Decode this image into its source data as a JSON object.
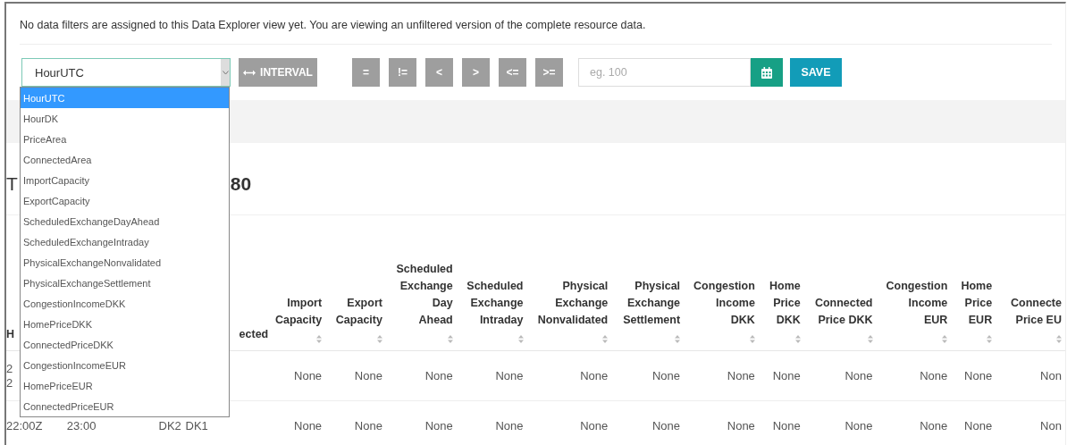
{
  "notice": "No data filters are assigned to this Data Explorer view yet. You are viewing an unfiltered version of the complete resource data.",
  "filter": {
    "field_select": {
      "value": "HourUTC",
      "expanded": true,
      "options": [
        {
          "label": "HourUTC",
          "selected": true
        },
        {
          "label": "HourDK",
          "selected": false
        },
        {
          "label": "PriceArea",
          "selected": false
        },
        {
          "label": "ConnectedArea",
          "selected": false
        },
        {
          "label": "ImportCapacity",
          "selected": false
        },
        {
          "label": "ExportCapacity",
          "selected": false
        },
        {
          "label": "ScheduledExchangeDayAhead",
          "selected": false
        },
        {
          "label": "ScheduledExchangeIntraday",
          "selected": false
        },
        {
          "label": "PhysicalExchangeNonvalidated",
          "selected": false
        },
        {
          "label": "PhysicalExchangeSettlement",
          "selected": false
        },
        {
          "label": "CongestionIncomeDKK",
          "selected": false
        },
        {
          "label": "HomePriceDKK",
          "selected": false
        },
        {
          "label": "ConnectedPriceDKK",
          "selected": false
        },
        {
          "label": "CongestionIncomeEUR",
          "selected": false
        },
        {
          "label": "HomePriceEUR",
          "selected": false
        },
        {
          "label": "ConnectedPriceEUR",
          "selected": false
        }
      ]
    },
    "interval_button": "INTERVAL",
    "operators": [
      "=",
      "!=",
      "<",
      ">",
      "<=",
      ">="
    ],
    "value_field": {
      "placeholder": "eg. 100"
    },
    "save_button": "SAVE"
  },
  "heading": {
    "lead": "T",
    "count": "80"
  },
  "table": {
    "columns": [
      {
        "label": "H",
        "sort": false
      },
      {
        "sort": false
      },
      {
        "sort": false
      },
      {
        "label": "ected",
        "sort": false
      },
      {
        "label": "Import\nCapacity",
        "sort": true
      },
      {
        "label": "Export\nCapacity",
        "sort": true
      },
      {
        "label": "Scheduled\nExchange\nDay\nAhead",
        "sort": true
      },
      {
        "label": "Scheduled\nExchange\nIntraday",
        "sort": true
      },
      {
        "label": "Physical\nExchange\nNonvalidated",
        "sort": true
      },
      {
        "label": "Physical\nExchange\nSettlement",
        "sort": true
      },
      {
        "label": "Congestion\nIncome\nDKK",
        "sort": true
      },
      {
        "label": "Home\nPrice\nDKK",
        "sort": true
      },
      {
        "label": "Connected\nPrice DKK",
        "sort": true
      },
      {
        "label": "Congestion\nIncome\nEUR",
        "sort": true
      },
      {
        "label": "Home\nPrice\nEUR",
        "sort": true
      },
      {
        "label": "Connecte\nPrice EU",
        "sort": true
      }
    ],
    "rows": [
      {
        "cells": [
          "2\n2",
          null,
          null,
          null,
          "None",
          "None",
          "None",
          "None",
          "None",
          "None",
          "None",
          "None",
          "None",
          "None",
          "None",
          "Non"
        ]
      },
      {
        "cells": [
          "22:00Z",
          "23:00",
          "DK2",
          "DK1",
          "None",
          "None",
          "None",
          "None",
          "None",
          "None",
          "None",
          "None",
          "None",
          "None",
          "None",
          "Non"
        ]
      }
    ]
  }
}
